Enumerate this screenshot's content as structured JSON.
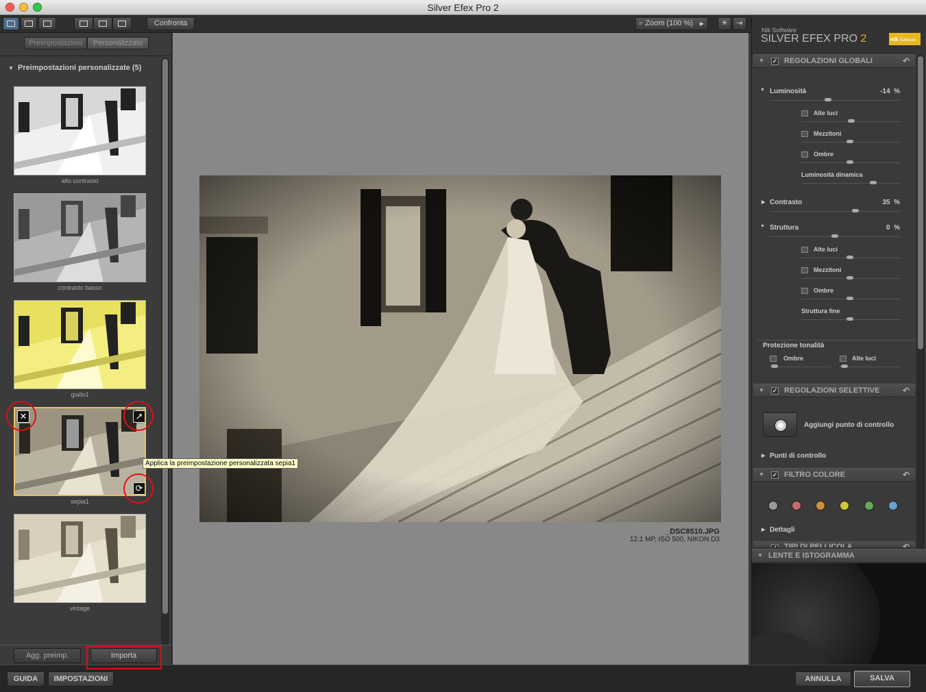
{
  "window": {
    "title": "Silver Efex Pro 2"
  },
  "toolbar": {
    "confronta": "Confronta",
    "zoom": "Zoom (100 %)"
  },
  "left_panel": {
    "tabs": [
      "Preimpostazioni",
      "Personalizzato"
    ],
    "section_title": "Preimpostazioni personalizzate (5)",
    "presets": [
      {
        "label": "alto contrasto",
        "tint": "#cfcfcf"
      },
      {
        "label": "contrasto basso",
        "tint": "#9a9a9a"
      },
      {
        "label": "giallo1",
        "tint": "#f0e870"
      },
      {
        "label": "sepia1",
        "tint": "#b0a890"
      },
      {
        "label": "vintage",
        "tint": "#ded6c0"
      }
    ],
    "tooltip": "Applica la preimpostazione personalizzata sepia1",
    "add_button": "Agg. preimp.",
    "import_button": "Importa"
  },
  "image_info": {
    "filename": "_DSC8510.JPG",
    "meta": "12.1 MP, ISO 500, NIKON D3"
  },
  "right_panel": {
    "brand_small": "Nik Software",
    "brand_big": "SILVER EFEX PRO",
    "brand_num": "2",
    "logo_text": "nik",
    "logo_sub": "Software",
    "global": {
      "title": "REGOLAZIONI GLOBALI",
      "brightness_label": "Luminosità",
      "brightness_value": "-14",
      "contrast_label": "Contrasto",
      "contrast_value": "35",
      "structure_label": "Struttura",
      "structure_value": "0",
      "percent": "%",
      "highlights": "Alte luci",
      "midtones": "Mezzitoni",
      "shadows": "Ombre",
      "dynamic": "Luminosità dinamica",
      "fine_structure": "Struttura fine",
      "tonal_protection": "Protezione tonalità"
    },
    "selective": {
      "title": "REGOLAZIONI SELETTIVE",
      "add_point": "Aggiungi punto di controllo",
      "points": "Punti di controllo"
    },
    "color_filter": {
      "title": "FILTRO COLORE",
      "details": "Dettagli",
      "colors": [
        "#9a9a9a",
        "#c86a6a",
        "#d0903a",
        "#d0c83a",
        "#6aa85a",
        "#6aa0d0"
      ]
    },
    "film_types": {
      "title": "TIPI DI PELLICOLA"
    },
    "loupe": {
      "title": "LENTE E ISTOGRAMMA"
    }
  },
  "bottom": {
    "guida": "GUIDA",
    "impostazioni": "IMPOSTAZIONI",
    "annulla": "ANNULLA",
    "salva": "SALVA"
  }
}
